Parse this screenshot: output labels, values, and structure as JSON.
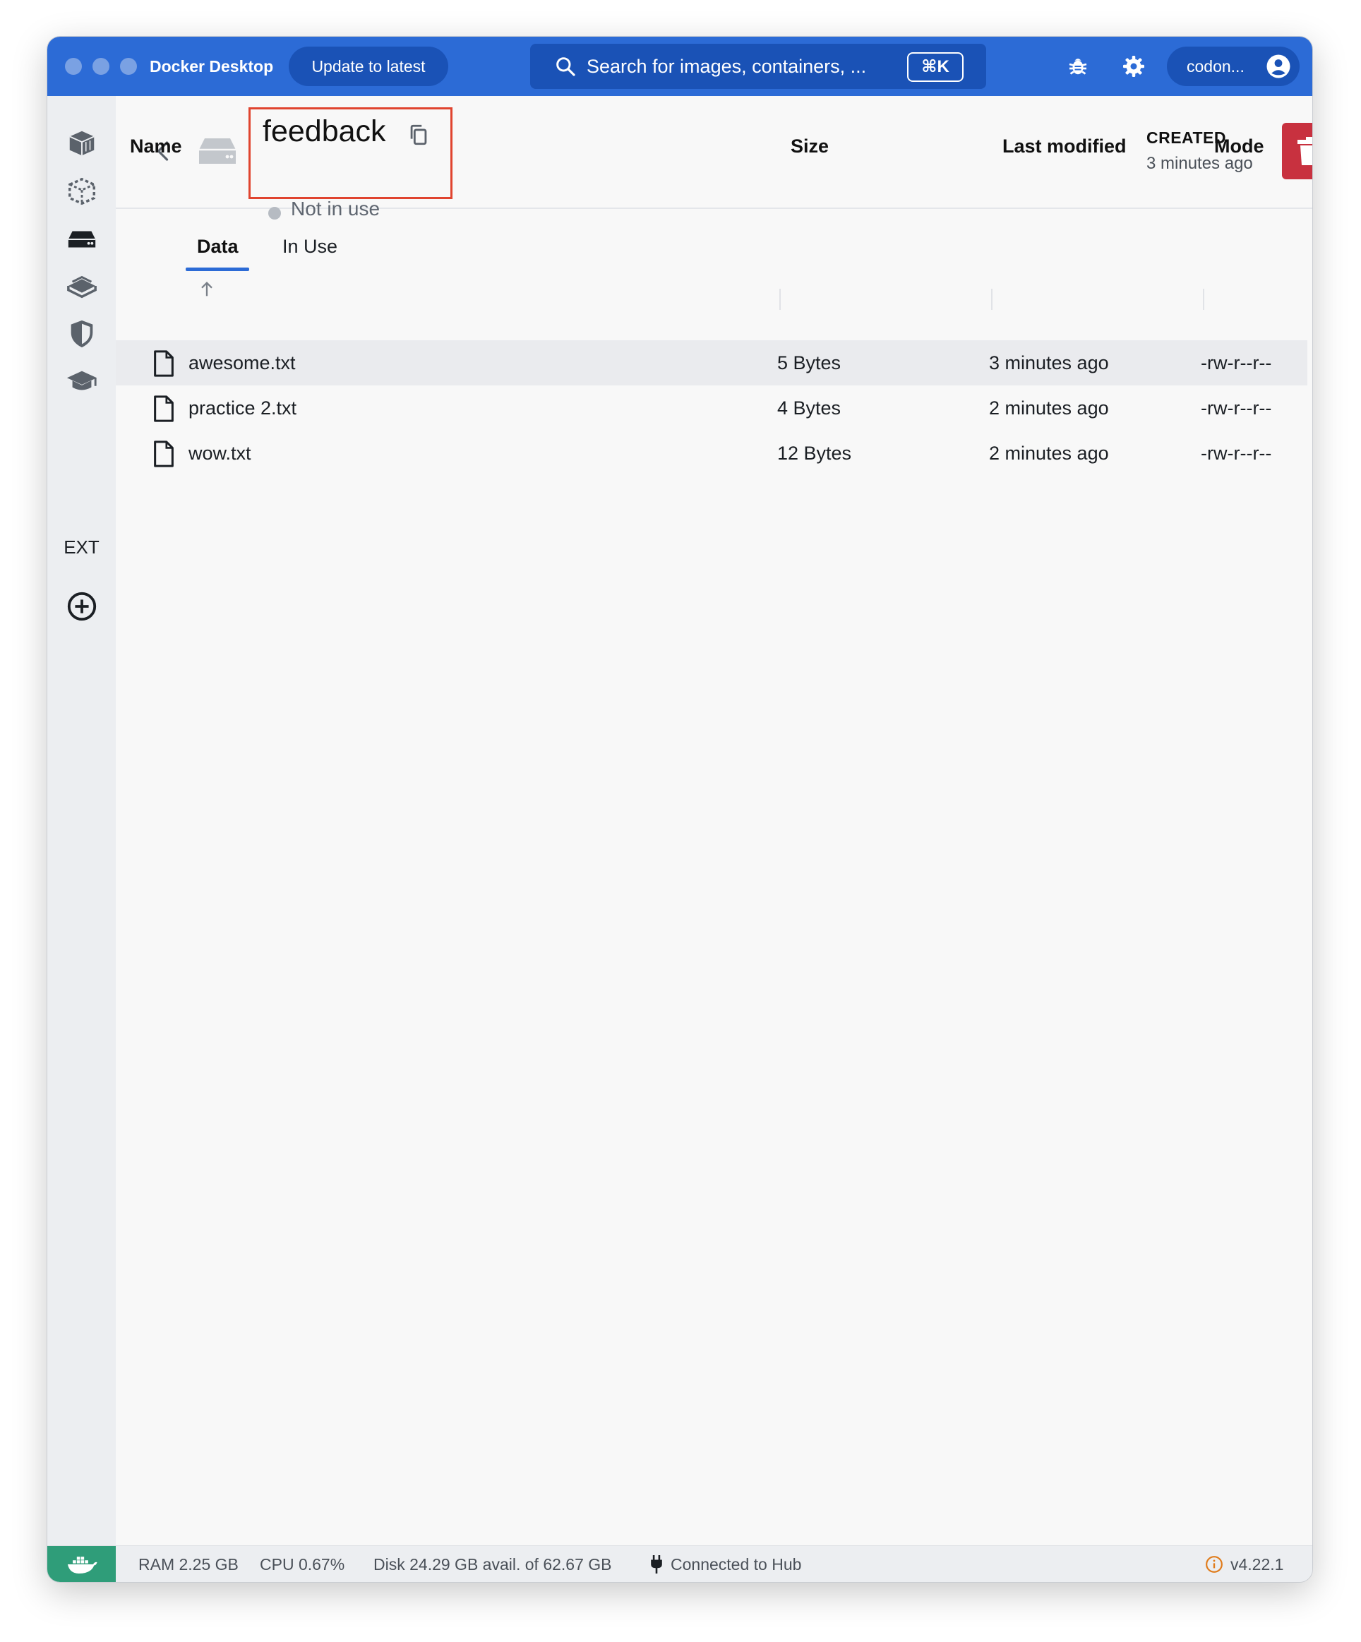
{
  "titlebar": {
    "app_title": "Docker Desktop",
    "update_label": "Update to latest",
    "search_placeholder": "Search for images, containers, ...",
    "search_shortcut": "⌘K",
    "user_name": "codon..."
  },
  "volume": {
    "name": "feedback",
    "status": "Not in use",
    "created_label": "CREATED",
    "created_value": "3 minutes ago"
  },
  "tabs": [
    {
      "label": "Data",
      "active": true
    },
    {
      "label": "In Use",
      "active": false
    }
  ],
  "table": {
    "columns": [
      "Name",
      "Size",
      "Last modified",
      "Mode"
    ],
    "rows": [
      {
        "name": "awesome.txt",
        "size": "5 Bytes",
        "modified": "3 minutes ago",
        "mode": "-rw-r--r--"
      },
      {
        "name": "practice 2.txt",
        "size": "4 Bytes",
        "modified": "2 minutes ago",
        "mode": "-rw-r--r--"
      },
      {
        "name": "wow.txt",
        "size": "12 Bytes",
        "modified": "2 minutes ago",
        "mode": "-rw-r--r--"
      }
    ]
  },
  "sidebar": {
    "ext_label": "EXT",
    "icons": [
      "containers-icon",
      "images-icon",
      "volumes-icon",
      "dev-environments-icon",
      "docker-scout-icon",
      "learning-center-icon",
      "add-extension-icon"
    ]
  },
  "footer": {
    "ram": "RAM 2.25 GB",
    "cpu": "CPU 0.67%",
    "disk": "Disk 24.29 GB avail. of 62.67 GB",
    "hub": "Connected to Hub",
    "version": "v4.22.1"
  },
  "colors": {
    "accent": "#2c6bd6",
    "delete": "#c8313f",
    "highlight": "#e0442f",
    "engine_running": "#2f9d79"
  }
}
